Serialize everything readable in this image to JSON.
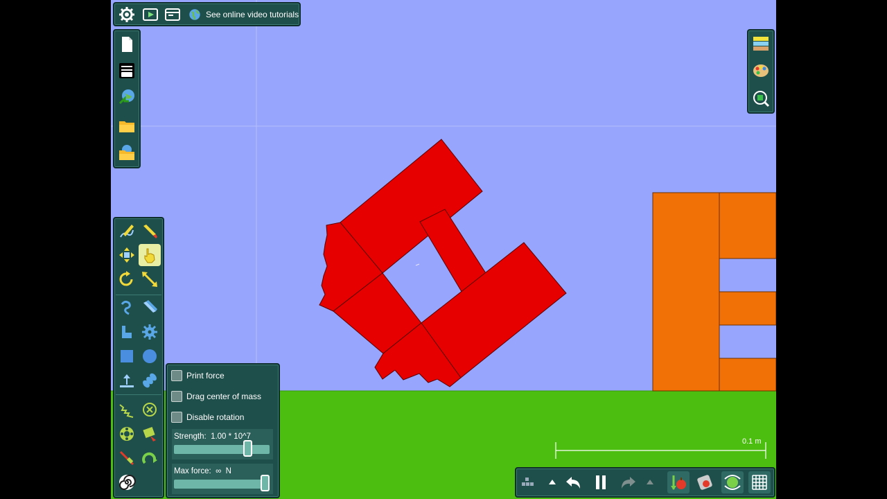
{
  "colors": {
    "sky": "#98a5fc",
    "ground": "#4bbe0f",
    "red_body": "#e60000",
    "orange_body": "#f27107",
    "panel": "#1f4f4b",
    "panel_highlight": "#e9eea5"
  },
  "top_bar": {
    "items": [
      {
        "icon": "gear-icon"
      },
      {
        "icon": "play-video-icon"
      },
      {
        "icon": "window-icon"
      }
    ],
    "tutorials_icon": "globe-icon",
    "tutorials_label": "See online video tutorials"
  },
  "file_menu": {
    "items": [
      "new-scene-icon",
      "gallery-icon",
      "publish-icon",
      "open-folder-icon",
      "open-online-icon"
    ]
  },
  "right_toolbar": {
    "items": [
      "background-layers-icon",
      "palette-icon",
      "zoom-to-fit-icon"
    ]
  },
  "tools": {
    "selected": "drag-hand-icon",
    "rows": [
      [
        "sketch-icon",
        "brush-icon"
      ],
      [
        "move-icon",
        "drag-hand-icon"
      ],
      [
        "rotate-icon",
        "scale-icon"
      ],
      [
        "rope-icon",
        "cut-icon"
      ],
      [
        "plane-icon",
        "gear-shape-icon"
      ],
      [
        "box-icon",
        "circle-icon"
      ],
      [
        "fixate-icon",
        "spring-icon"
      ],
      [
        "zigzag-spring-icon",
        "axle-icon"
      ],
      [
        "thruster-icon",
        "tracer-icon"
      ],
      [
        "laser-icon",
        "hinge-icon"
      ],
      [
        "spiral-icon"
      ]
    ]
  },
  "drag_options": {
    "print_force": "Print force",
    "drag_center_of_mass": "Drag center of mass",
    "disable_rotation": "Disable rotation",
    "strength_label": "Strength:",
    "strength_value": "1.00 * 10^7",
    "strength_fraction": 0.8,
    "max_force_label": "Max force:",
    "max_force_value": "∞",
    "max_force_unit": "N",
    "max_force_fraction": 1.0
  },
  "scale_bar": {
    "label": "0.1 m"
  },
  "bottom_bar": {
    "items": [
      "blocks-icon",
      "up-arrow-icon",
      "undo-icon",
      "pause-icon",
      "redo-icon",
      "up-arrow-icon",
      "gravity-icon",
      "air-friction-icon",
      "follow-icon",
      "grid-icon"
    ]
  }
}
